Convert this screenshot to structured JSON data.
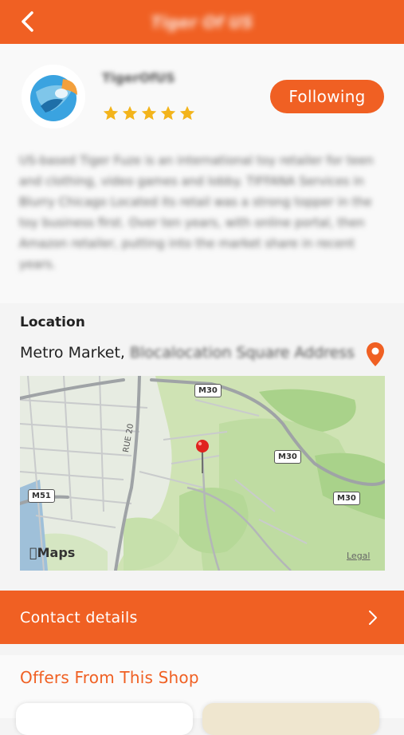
{
  "header": {
    "title": "Tiger Of US",
    "back_icon": "chevron-left-icon"
  },
  "shop": {
    "name": "TigerOfUS",
    "rating": 5,
    "follow_label": "Following",
    "description": "US-based Tiger Fuze is an international toy retailer for teen and clothing, video games and lobby. TIFFANA Services in Blurry Chicago Located its retail was a strong topper in the toy business first. Over ten years, with online portal, then Amazon retailer, putting into the market share in recent years."
  },
  "location": {
    "label": "Location",
    "address_visible": "Metro Market, ",
    "address_blurred": "Blocalocation Square Address",
    "pin_icon": "location-pin-icon"
  },
  "map": {
    "roads": [
      "M30",
      "M30",
      "M30",
      "M51",
      "RUE 20"
    ],
    "attribution": "Maps",
    "legal": "Legal"
  },
  "contact": {
    "label": "Contact details",
    "chevron_icon": "chevron-right-icon"
  },
  "offers": {
    "title": "Offers From This Shop"
  },
  "colors": {
    "brand": "#f06023",
    "star": "#f3b41b"
  }
}
